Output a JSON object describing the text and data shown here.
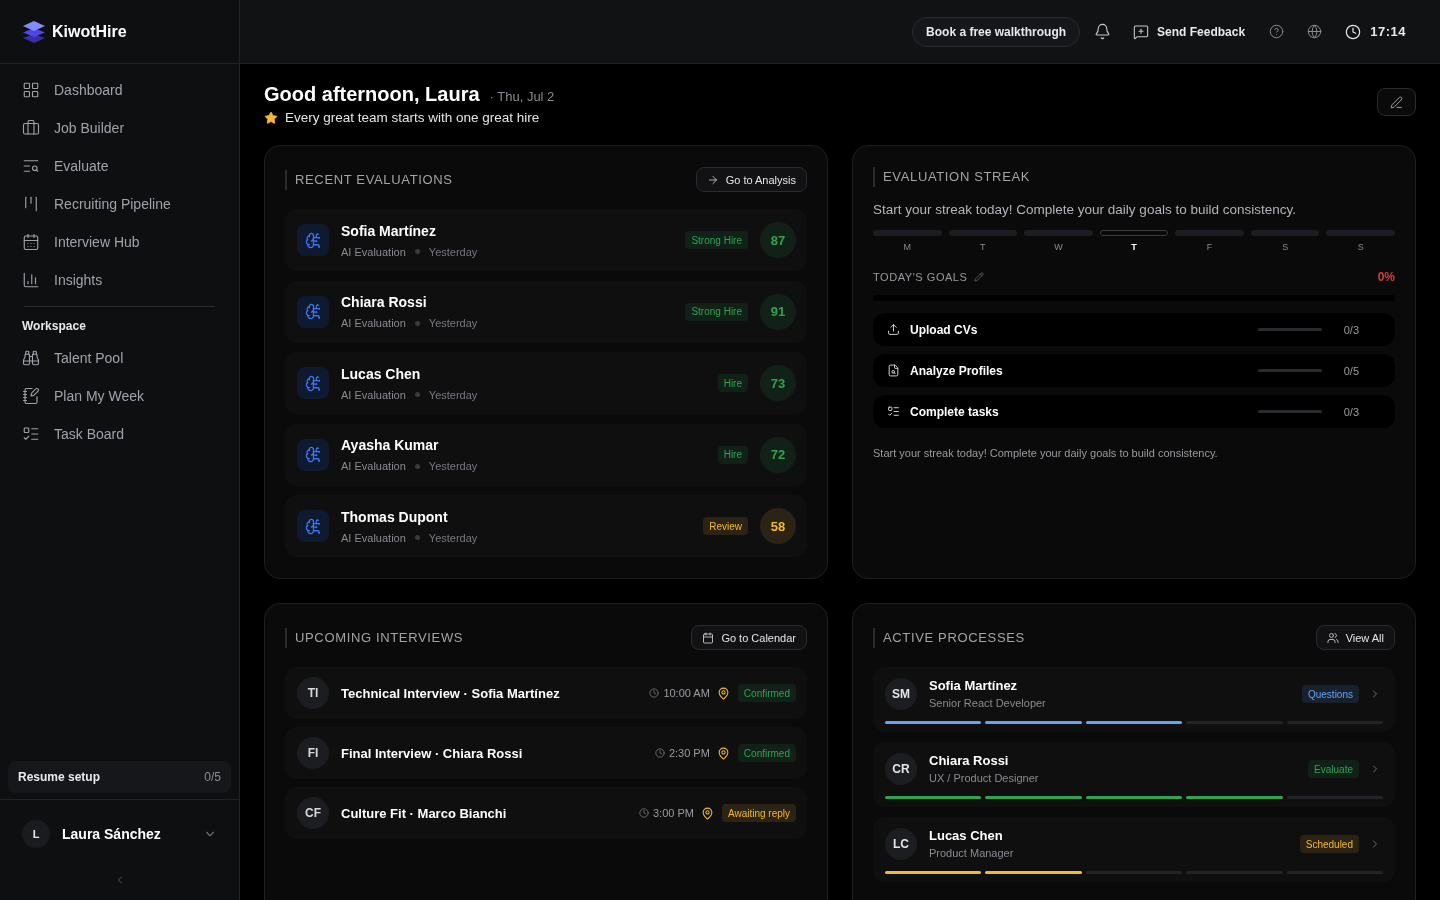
{
  "sidebar": {
    "brand": "KiwotHire",
    "nav": [
      "Dashboard",
      "Job Builder",
      "Evaluate",
      "Recruiting Pipeline",
      "Interview Hub",
      "Insights"
    ],
    "section": "Workspace",
    "workspace": [
      "Talent Pool",
      "Plan My Week",
      "Task Board"
    ],
    "setup": {
      "label": "Resume setup",
      "progress": "0/5"
    },
    "user": {
      "initial": "L",
      "name": "Laura Sánchez"
    }
  },
  "topbar": {
    "walkthrough": "Book a free walkthrough",
    "feedback": "Send Feedback",
    "time": "17:14"
  },
  "greeting": {
    "title": "Good afternoon, Laura",
    "date": "· Thu, Jul 2",
    "tagline": "Every great team starts with one great hire"
  },
  "recent_evaluations": {
    "title": "RECENT EVALUATIONS",
    "action": "Go to Analysis",
    "items": [
      {
        "name": "Sofia Martínez",
        "type": "AI Evaluation",
        "when": "Yesterday",
        "verdict": "Strong Hire",
        "score": "87",
        "color": "#2da44e"
      },
      {
        "name": "Chiara Rossi",
        "type": "AI Evaluation",
        "when": "Yesterday",
        "verdict": "Strong Hire",
        "score": "91",
        "color": "#2da44e"
      },
      {
        "name": "Lucas Chen",
        "type": "AI Evaluation",
        "when": "Yesterday",
        "verdict": "Hire",
        "score": "73",
        "color": "#2da44e"
      },
      {
        "name": "Ayasha Kumar",
        "type": "AI Evaluation",
        "when": "Yesterday",
        "verdict": "Hire",
        "score": "72",
        "color": "#2da44e"
      },
      {
        "name": "Thomas Dupont",
        "type": "AI Evaluation",
        "when": "Yesterday",
        "verdict": "Review",
        "score": "58",
        "color": "#f5b82e"
      }
    ]
  },
  "evaluation_streak": {
    "title": "EVALUATION STREAK",
    "intro": "Start your streak today! Complete your daily goals to build consistency.",
    "days": [
      {
        "label": "M",
        "today": false
      },
      {
        "label": "T",
        "today": false
      },
      {
        "label": "W",
        "today": false
      },
      {
        "label": "T",
        "today": true
      },
      {
        "label": "F",
        "today": false
      },
      {
        "label": "S",
        "today": false
      },
      {
        "label": "S",
        "today": false
      }
    ],
    "goals_title": "TODAY'S GOALS",
    "percent": "0%",
    "level": 0,
    "goals": [
      {
        "label": "Upload CVs",
        "level": 0,
        "count": "0/3"
      },
      {
        "label": "Analyze Profiles",
        "level": 0,
        "count": "0/5"
      },
      {
        "label": "Complete tasks",
        "level": 0,
        "count": "0/3"
      }
    ],
    "footer": "Start your streak today! Complete your daily goals to build consistency."
  },
  "upcoming_interviews": {
    "title": "UPCOMING INTERVIEWS",
    "action": "Go to Calendar",
    "items": [
      {
        "initials": "TI",
        "title": "Technical Interview · Sofia Martínez",
        "time": "10:00 AM",
        "status": "Confirmed",
        "color": "#2da44e"
      },
      {
        "initials": "FI",
        "title": "Final Interview · Chiara Rossi",
        "time": "2:30 PM",
        "status": "Confirmed",
        "color": "#2da44e"
      },
      {
        "initials": "CF",
        "title": "Culture Fit · Marco Bianchi",
        "time": "3:00 PM",
        "status": "Awaiting reply",
        "color": "#f5b82e"
      }
    ]
  },
  "active_processes": {
    "title": "ACTIVE PROCESSES",
    "action": "View All",
    "items": [
      {
        "initials": "SM",
        "name": "Sofia Martínez",
        "role": "Senior React Developer",
        "stage": "Questions",
        "color": "#60a5fa",
        "level": 0.6
      },
      {
        "initials": "CR",
        "name": "Chiara Rossi",
        "role": "UX / Product Designer",
        "stage": "Evaluate",
        "color": "#2da44e",
        "level": 0.8
      },
      {
        "initials": "LC",
        "name": "Lucas Chen",
        "role": "Product Manager",
        "stage": "Scheduled",
        "color": "#f5b82e",
        "level": 0.4
      }
    ]
  }
}
